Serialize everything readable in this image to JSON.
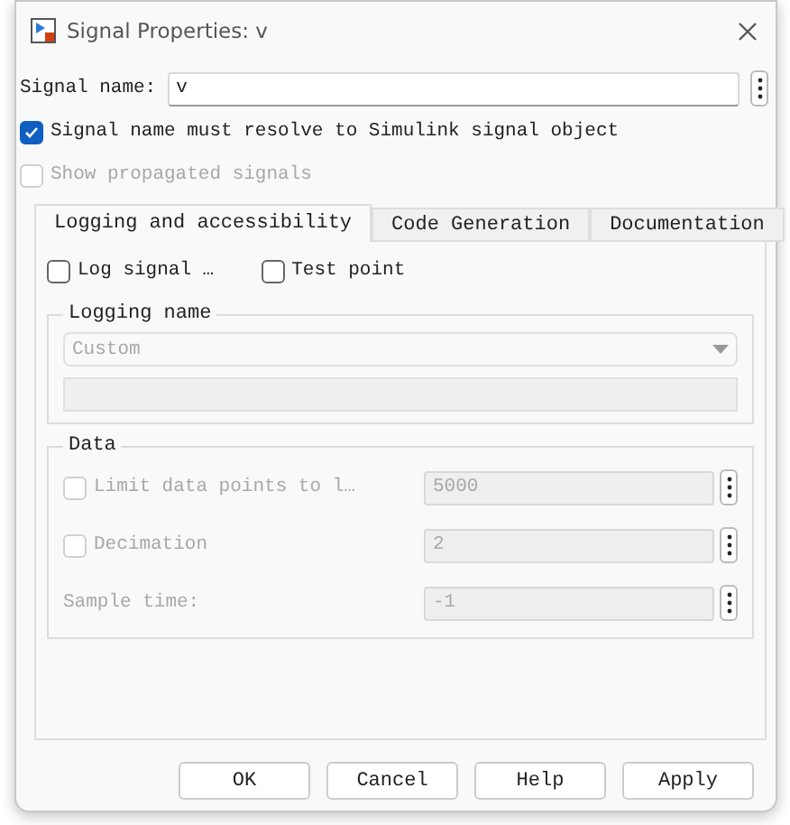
{
  "window": {
    "title": "Signal Properties: v"
  },
  "signal_name": {
    "label": "Signal name:",
    "value": "v"
  },
  "options": [
    {
      "label": "Signal name must resolve to Simulink signal object",
      "checked": true,
      "disabled": false
    },
    {
      "label": "Show propagated signals",
      "checked": false,
      "disabled": true
    }
  ],
  "tabs": [
    {
      "label": "Logging and accessibility",
      "selected": true
    },
    {
      "label": "Code Generation",
      "selected": false
    },
    {
      "label": "Documentation",
      "selected": false
    }
  ],
  "logging_options": [
    {
      "label": "Log signal …",
      "checked": false
    },
    {
      "label": "Test point",
      "checked": false
    }
  ],
  "logging_name": {
    "title": "Logging name",
    "dropdown": "Custom",
    "disabled": true
  },
  "data": {
    "title": "Data",
    "rows": [
      {
        "kind": "checkbox",
        "label": "Limit data points to l…",
        "checked": false,
        "disabled": true,
        "value": "5000"
      },
      {
        "kind": "checkbox",
        "label": "Decimation",
        "checked": false,
        "disabled": true,
        "value": "2"
      },
      {
        "kind": "label",
        "label": "Sample time:",
        "disabled": true,
        "value": "-1"
      }
    ]
  },
  "buttons": [
    "OK",
    "Cancel",
    "Help",
    "Apply"
  ]
}
